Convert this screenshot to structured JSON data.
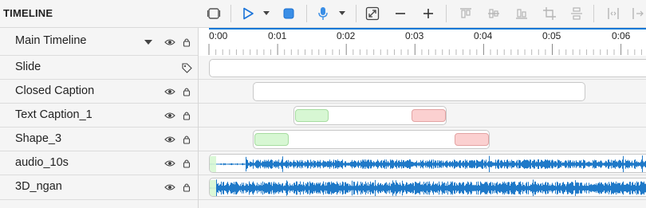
{
  "header": {
    "title": "TIMELINE"
  },
  "toolbar": {
    "icons": [
      "frame-icon",
      "play-icon",
      "play-options-chevron-icon",
      "stop-icon",
      "microphone-icon",
      "microphone-options-chevron-icon",
      "fit-icon",
      "zoom-out-icon",
      "zoom-in-icon",
      "align-top-icon",
      "align-middle-icon",
      "align-bottom-icon",
      "crop-icon",
      "distribute-icon",
      "split-icon",
      "expand-icon"
    ]
  },
  "ruler": {
    "labels": [
      "0:00",
      "0:01",
      "0:02",
      "0:03",
      "0:04",
      "0:05",
      "0:06"
    ]
  },
  "rows": [
    {
      "label": "Main Timeline",
      "type": "main"
    },
    {
      "label": "Slide",
      "type": "slide"
    },
    {
      "label": "Closed Caption",
      "type": "object"
    },
    {
      "label": "Text Caption_1",
      "type": "object"
    },
    {
      "label": "Shape_3",
      "type": "object"
    },
    {
      "label": "audio_10s",
      "type": "audio"
    },
    {
      "label": "3D_ngan",
      "type": "audio"
    }
  ],
  "colors": {
    "accent": "#0078d7",
    "waveform": "#1f79c8",
    "fade_in": "#d7f7d3",
    "fade_out": "#fbd0d0"
  }
}
